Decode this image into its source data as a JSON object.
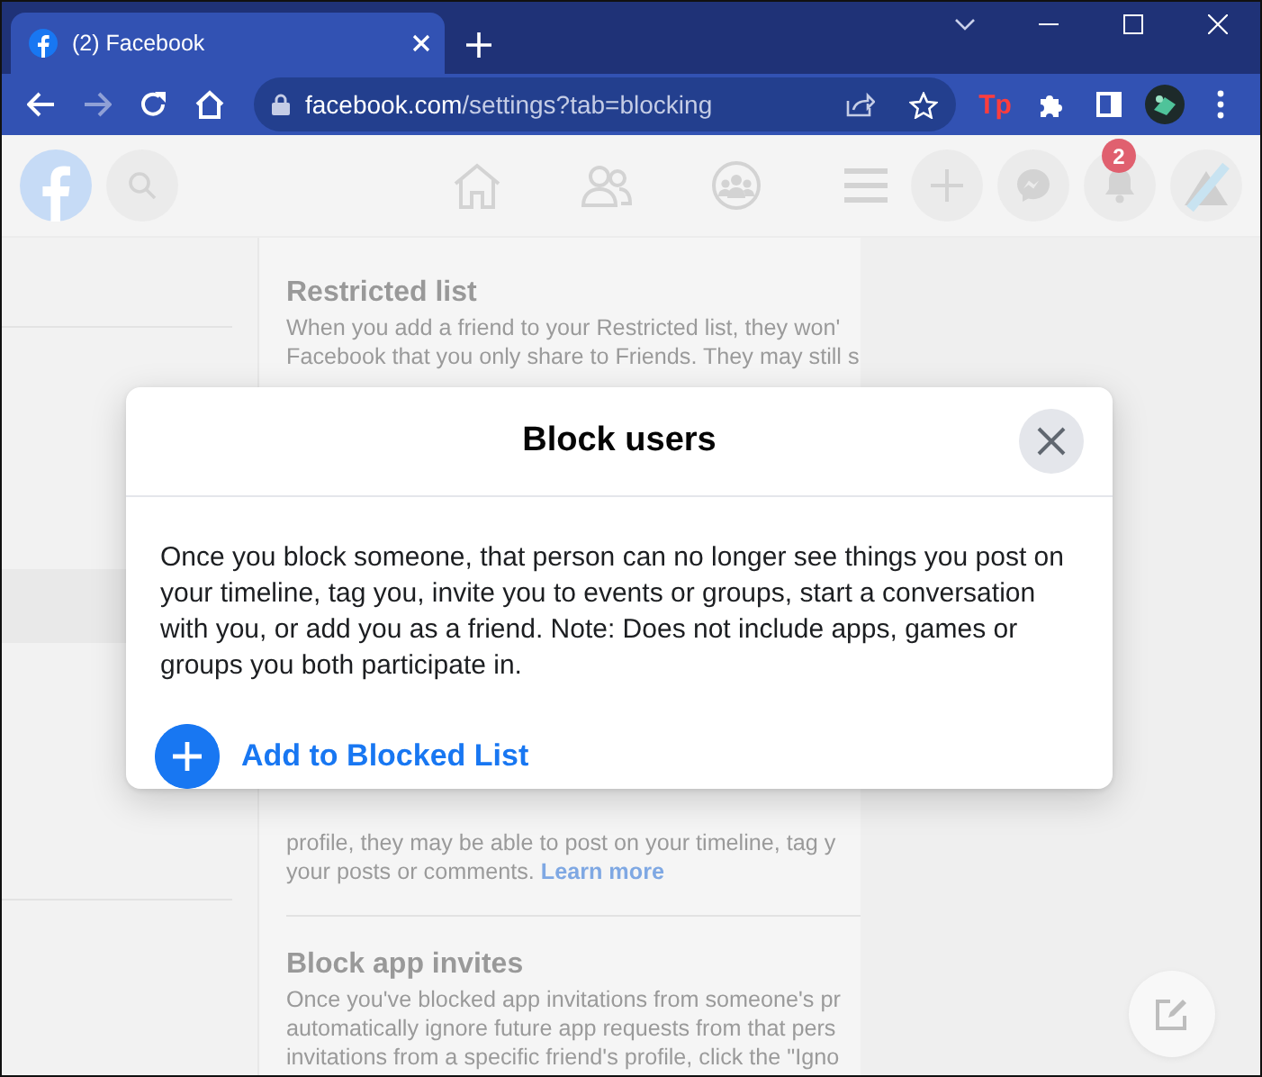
{
  "browser": {
    "tab_title": "(2) Facebook",
    "url_host": "facebook.com",
    "url_path": "/settings?tab=blocking",
    "extension_label": "Tp"
  },
  "header": {
    "notification_count": "2"
  },
  "settings": {
    "sections": [
      {
        "title": "Restricted list",
        "lines": [
          "When you add a friend to your Restricted list, they won'",
          "Facebook that you only share to Friends. They may still s"
        ]
      },
      {
        "lines": [
          "profile, they may be able to post on your timeline, tag y",
          "your posts or comments."
        ],
        "link": "Learn more"
      },
      {
        "title": "Block app invites",
        "lines": [
          "Once you've blocked app invitations from someone's pr",
          "automatically ignore future app requests from that pers",
          "invitations from a specific friend's profile, click the \"Igno"
        ]
      }
    ]
  },
  "dialog": {
    "title": "Block users",
    "body": "Once you block someone, that person can no longer see things you post on your timeline, tag you, invite you to events or groups, start a conversation with you, or add you as a friend. Note: Does not include apps, games or groups you both participate in.",
    "action": "Add to Blocked List"
  }
}
